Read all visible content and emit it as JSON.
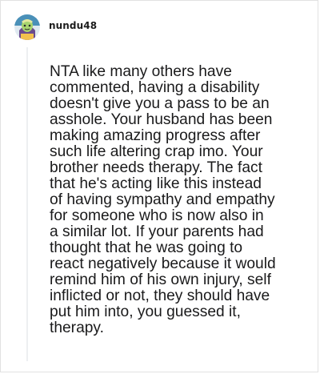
{
  "comment": {
    "author": "nundu48",
    "avatar_icon": "cartoon-character-avatar",
    "lines": [
      "NTA like many others have",
      "commented, having a disability",
      "doesn't give you a pass to be an",
      "asshole. Your husband has been",
      "making amazing progress after",
      "such life altering crap imo. Your",
      "brother needs therapy. The fact",
      "that he's acting like this instead",
      "of having sympathy and empathy",
      "for someone who is now also in",
      "a similar lot. If your parents had",
      "thought that he was going to",
      "react negatively because it would",
      "remind him of his own injury, self",
      "inflicted or not, they should have",
      "put him into, you guessed it,",
      "therapy."
    ]
  },
  "colors": {
    "text": "#1a1a1b",
    "thread_line": "#edeff1",
    "avatar_bg": "#4a90b8",
    "avatar_face": "#a8d46f"
  }
}
